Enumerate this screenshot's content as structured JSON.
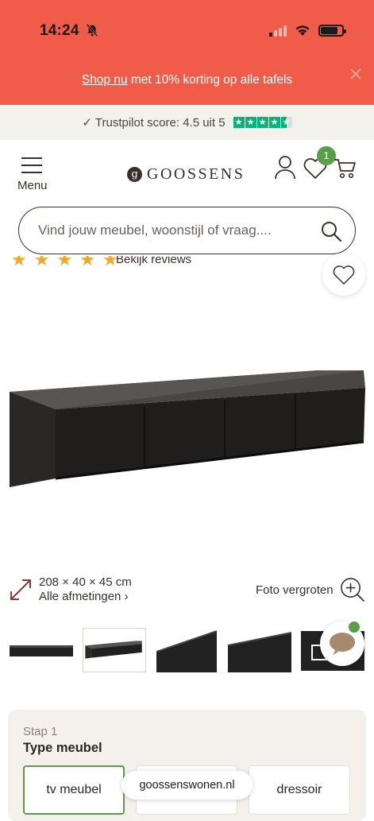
{
  "status_bar": {
    "time": "14:24"
  },
  "promo": {
    "link_text": "Shop nu",
    "rest_text": " met 10% korting op alle tafels"
  },
  "trustpilot": {
    "text": "✓ Trustpilot score: 4.5 uit 5",
    "score": 4.5,
    "max": 5
  },
  "header": {
    "menu_label": "Menu",
    "logo_text": "GOOSSENS",
    "logo_mark": "g",
    "wishlist_count": "1"
  },
  "search": {
    "placeholder": "Vind jouw meubel, woonstijl of vraag...."
  },
  "reviews": {
    "link_text": "Bekijk reviews",
    "stars": 5
  },
  "product": {
    "dimensions": "208 × 40 × 45 cm",
    "all_dimensions_link": "Alle afmetingen ›",
    "zoom_label": "Foto vergroten"
  },
  "configurator": {
    "step_label": "Stap 1",
    "step_title": "Type meubel",
    "options": [
      {
        "label": "tv meubel",
        "selected": true
      },
      {
        "label": "",
        "selected": false
      },
      {
        "label": "dressoir",
        "selected": false
      }
    ]
  },
  "browser": {
    "url": "goossenswonen.nl"
  },
  "colors": {
    "promo": "#f15b4a",
    "accent_green": "#5a9e4a",
    "brown": "#3a2f2a",
    "trustpilot": "#00b67a"
  }
}
